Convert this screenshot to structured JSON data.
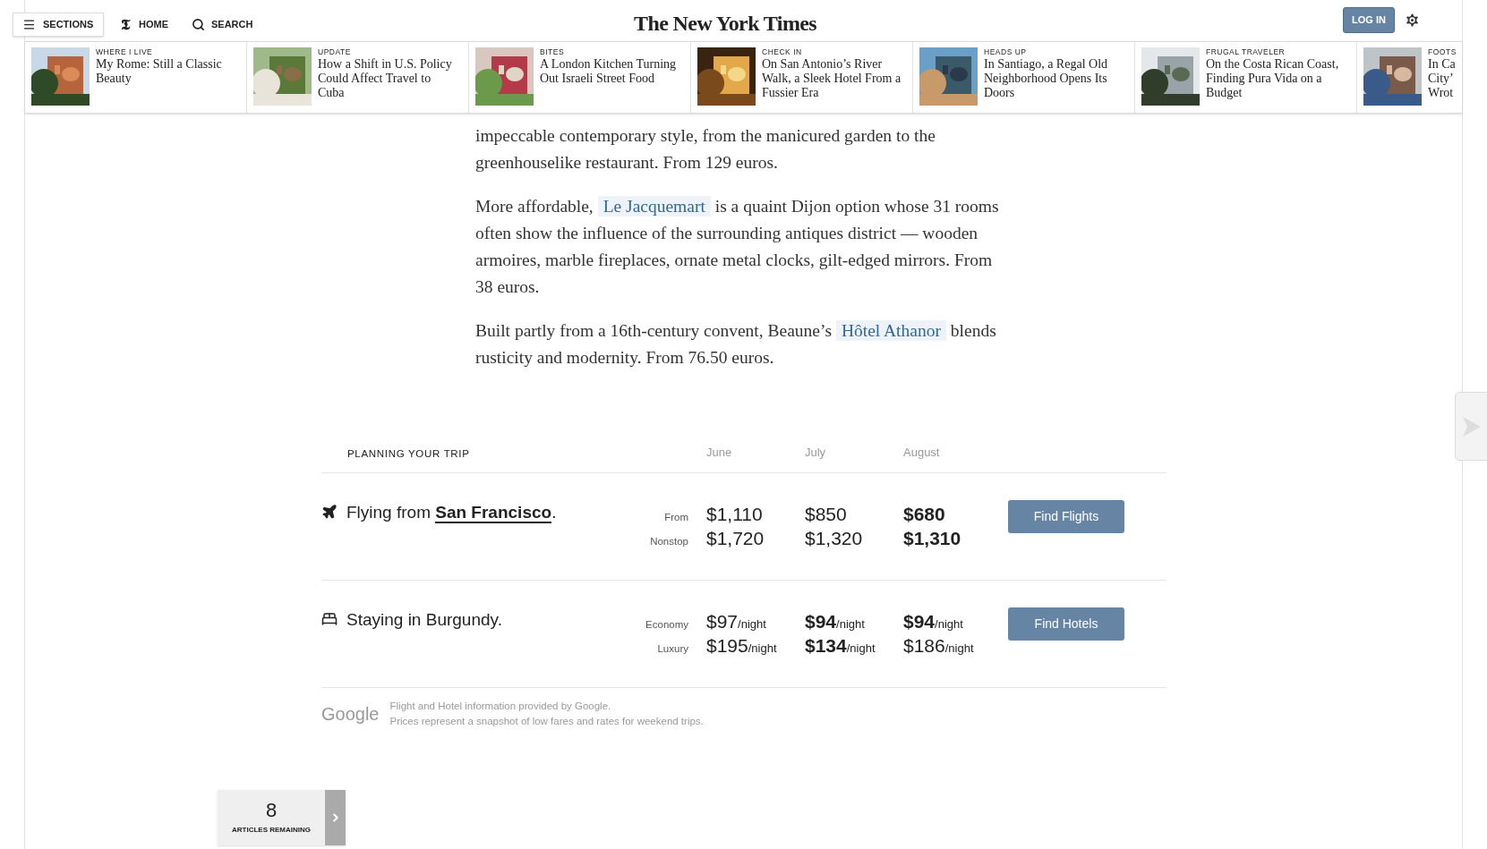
{
  "header": {
    "sections": "SECTIONS",
    "home_mark": "𝕿",
    "home": "HOME",
    "search": "SEARCH",
    "logo": "The New York Times",
    "login": "LOG IN"
  },
  "ribbon": [
    {
      "kicker": "WHERE I LIVE",
      "headline": [
        "My Rome: Still a Classic",
        "Beauty"
      ]
    },
    {
      "kicker": "UPDATE",
      "headline": [
        "How a Shift in U.S. Policy",
        "Could Affect Travel to",
        "Cuba"
      ]
    },
    {
      "kicker": "BITES",
      "headline": [
        "A London Kitchen Turning",
        "Out Israeli Street Food"
      ]
    },
    {
      "kicker": "CHECK IN",
      "headline": [
        "On San Antonio’s River",
        "Walk, a Sleek Hotel From a",
        "Fussier Era"
      ]
    },
    {
      "kicker": "HEADS UP",
      "headline": [
        "In Santiago, a Regal Old",
        "Neighborhood Opens Its",
        "Doors"
      ]
    },
    {
      "kicker": "FRUGAL TRAVELER",
      "headline": [
        "On the Costa Rican Coast,",
        "Finding Pura Vida on a",
        "Budget"
      ]
    },
    {
      "kicker": "FOOTS",
      "headline": [
        "In Ca",
        "City’",
        "Wrot"
      ]
    }
  ],
  "paragraphs": [
    [
      {
        "kind": "text",
        "text": "impeccable contemporary style, from the manicured garden to the greenhouselike restaurant. From 129 euros."
      }
    ],
    [
      {
        "kind": "text",
        "text": "More affordable, "
      },
      {
        "kind": "link",
        "text": "Le Jacquemart"
      },
      {
        "kind": "text",
        "text": " is a quaint Dijon option whose 31 rooms often show the influence of the surrounding antiques district — wooden armoires, marble fireplaces, ornate metal clocks, gilt-edged mirrors. From 38 euros."
      }
    ],
    [
      {
        "kind": "text",
        "text": "Built partly from a 16th-century convent, Beaune’s "
      },
      {
        "kind": "link",
        "text": "Hôtel Athanor"
      },
      {
        "kind": "text",
        "text": " blends rusticity and modernity. From 76.50 euros."
      }
    ]
  ],
  "trip": {
    "title": "PLANNING YOUR TRIP",
    "months": [
      "June",
      "July",
      "August"
    ],
    "rows": [
      {
        "kind": "flight",
        "label": [
          {
            "kind": "text",
            "text": "Flying from "
          },
          {
            "kind": "link",
            "text": "San Francisco"
          },
          {
            "kind": "text",
            "text": "."
          }
        ],
        "lines": [
          {
            "label": "From",
            "prices": [
              {
                "amount": "$1,110",
                "bold": false
              },
              {
                "amount": "$850",
                "bold": false
              },
              {
                "amount": "$680",
                "bold": true
              }
            ]
          },
          {
            "label": "Nonstop",
            "prices": [
              {
                "amount": "$1,720",
                "bold": false
              },
              {
                "amount": "$1,320",
                "bold": false
              },
              {
                "amount": "$1,310",
                "bold": true
              }
            ]
          }
        ],
        "button": "Find Flights"
      },
      {
        "kind": "hotel",
        "label": [
          {
            "kind": "text",
            "text": "Staying in Burgundy."
          }
        ],
        "lines": [
          {
            "label": "Economy",
            "prices": [
              {
                "amount": "$97",
                "unit": "/night",
                "bold": false
              },
              {
                "amount": "$94",
                "unit": "/night",
                "bold": true
              },
              {
                "amount": "$94",
                "unit": "/night",
                "bold": true
              }
            ]
          },
          {
            "label": "Luxury",
            "prices": [
              {
                "amount": "$195",
                "unit": "/night",
                "bold": false
              },
              {
                "amount": "$134",
                "unit": "/night",
                "bold": true
              },
              {
                "amount": "$186",
                "unit": "/night",
                "bold": false
              }
            ]
          }
        ],
        "button": "Find Hotels"
      }
    ],
    "provider": "Google",
    "notes": [
      "Flight and Hotel information provided by Google.",
      "Prices represent a snapshot of low fares and rates for weekend trips."
    ]
  },
  "meter": {
    "count": "8",
    "label": "ARTICLES REMAINING"
  }
}
